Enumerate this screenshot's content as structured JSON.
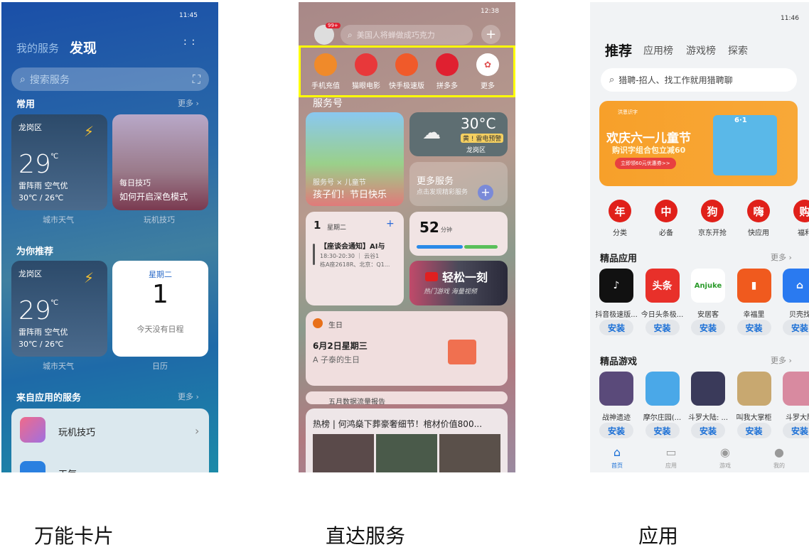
{
  "captions": [
    "万能卡片",
    "直达服务",
    "应用"
  ],
  "p1": {
    "time": "11:45",
    "tabs": [
      "我的服务",
      "发现"
    ],
    "search_placeholder": "搜索服务",
    "sec1": "常用",
    "more": "更多 ›",
    "weather": {
      "location": "龙岗区",
      "temp": "29",
      "unit": "℃",
      "desc": "雷阵雨 空气优",
      "range": "30℃ / 26℃"
    },
    "tips": {
      "tag": "每日技巧",
      "title": "如何开启深色模式"
    },
    "labels1": [
      "城市天气",
      "玩机技巧"
    ],
    "sec2": "为你推荐",
    "calendar": {
      "weekday": "星期二",
      "day": "1",
      "empty": "今天没有日程"
    },
    "labels2": [
      "城市天气",
      "日历"
    ],
    "sec3": "来自应用的服务",
    "list": [
      "玩机技巧",
      "天气"
    ]
  },
  "p2": {
    "time": "12:38",
    "badge": "99+",
    "search_placeholder": "美国人将蝉做成巧克力",
    "quick": [
      "手机充值",
      "猫眼电影",
      "快手极速版",
      "拼多多",
      "更多"
    ],
    "quick_colors": [
      "#f08a2a",
      "#e8383a",
      "#f05a2a",
      "#e02030",
      "#ffffff"
    ],
    "highlight_color": "#ffff00",
    "sec": "服务号",
    "promo": {
      "sub": "服务号 × 儿童节",
      "title": "孩子们！节日快乐"
    },
    "weather": {
      "temp": "30°C",
      "alert": "黄 ! 雷电预警",
      "loc": "龙岗区"
    },
    "more_services": {
      "title": "更多服务",
      "sub": "点击发现精彩服务"
    },
    "schedule": {
      "day": "1",
      "weekday": "星期二",
      "title": "【座谈会通知】AI与",
      "time": "18:30-20:30 ｜ 云谷1",
      "place": "栋A座2618R、北京：Q1..."
    },
    "usage": {
      "value": "52",
      "unit": "分钟",
      "progress": [
        0.55,
        0.4
      ]
    },
    "video": {
      "title": "轻松一刻",
      "sub": "热门游戏  海量视频"
    },
    "birthday": {
      "label": "生日",
      "date": "6月2日星期三",
      "name": "A 子泰的生日"
    },
    "partial": "五月数据流量报告",
    "news": "热榜 | 何鸿燊下葬豪奢细节！棺材价值800..."
  },
  "p3": {
    "time": "11:46",
    "tabs": [
      "推荐",
      "应用榜",
      "游戏榜",
      "探索"
    ],
    "search_placeholder": "猎聘-招人、找工作就用猎聘聊",
    "banner": {
      "brand": "洪恩识字",
      "title": "欢庆六一儿童节",
      "sub": "购识字组合包立减60",
      "cta": "立即领60元优惠券>>",
      "badge": "6·1"
    },
    "cats": [
      {
        "g": "年",
        "l": "分类"
      },
      {
        "g": "中",
        "l": "必备"
      },
      {
        "g": "狗",
        "l": "京东开抢"
      },
      {
        "g": "嗨",
        "l": "快应用"
      },
      {
        "g": "购",
        "l": "福利"
      }
    ],
    "apps_title": "精品应用",
    "more": "更多 ›",
    "apps": [
      "抖音极速版...",
      "今日头条极...",
      "安居客",
      "幸福里",
      "贝壳找"
    ],
    "app_icons": [
      {
        "t": "♪",
        "c": "#111"
      },
      {
        "t": "头条",
        "c": "#e8302a"
      },
      {
        "t": "Anjuke",
        "c": "#fff"
      },
      {
        "t": "▮",
        "c": "#f05a1e"
      },
      {
        "t": "⌂",
        "c": "#2a7af0"
      }
    ],
    "games_title": "精品游戏",
    "games": [
      "战神遗迹",
      "摩尔庄园(...",
      "斗罗大陆: ...",
      "叫我大掌柜",
      "斗罗大陆"
    ],
    "game_colors": [
      "#5a4a7a",
      "#4aa8e8",
      "#3a3a5a",
      "#c8a870",
      "#d88aa0"
    ],
    "install": "安装",
    "nav": [
      "首页",
      "应用",
      "游戏",
      "我的"
    ],
    "accent": "#1a6fd6"
  }
}
